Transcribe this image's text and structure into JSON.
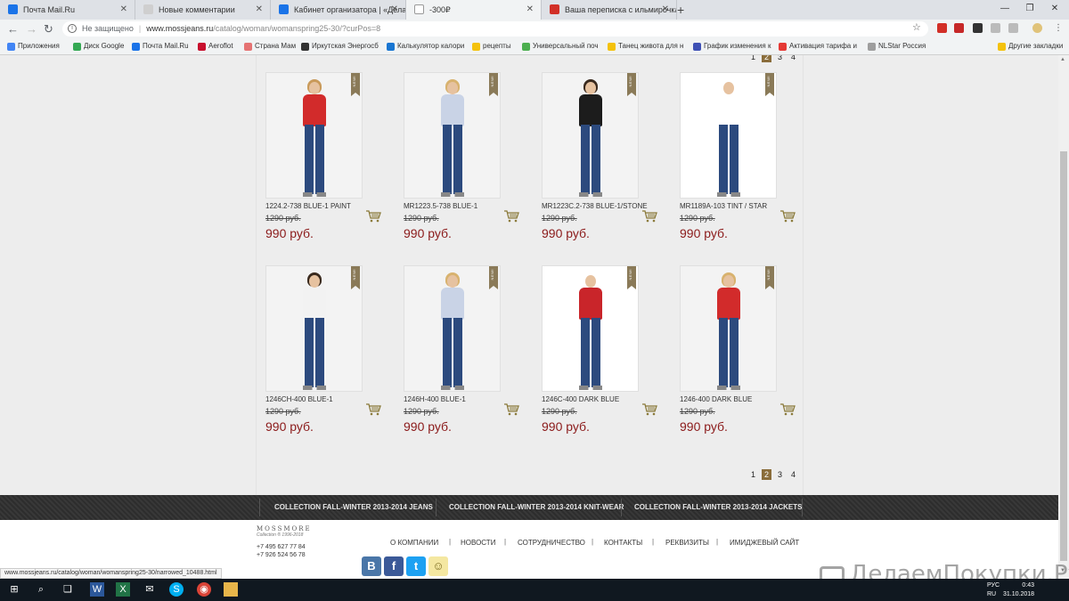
{
  "browser": {
    "tabs": [
      {
        "title": "Почта Mail.Ru",
        "color": "#1a73e8"
      },
      {
        "title": "Новые комментарии",
        "color": "#cccccc"
      },
      {
        "title": "Кабинет организатора | «Делае",
        "color": "#1a73e8"
      },
      {
        "title": "-300₽",
        "color": "#ffffff"
      },
      {
        "title": "Ваша переписка с ильмирочка",
        "color": "#d22f27"
      }
    ],
    "url": {
      "security": "Не защищено",
      "host": "www.mossjeans.ru",
      "path": "/catalog/woman/womanspring25-30/?curPos=8"
    },
    "bookmarks": [
      {
        "label": "Приложения",
        "color": "#4285f4"
      },
      {
        "label": "Диск Google",
        "color": "#34a853"
      },
      {
        "label": "Почта Mail.Ru",
        "color": "#1a73e8"
      },
      {
        "label": "Aeroflot",
        "color": "#c8102e"
      },
      {
        "label": "Страна Мам",
        "color": "#e57373"
      },
      {
        "label": "Иркутская Энергосб",
        "color": "#333333"
      },
      {
        "label": "Калькулятор калори",
        "color": "#1976d2"
      },
      {
        "label": "рецепты",
        "color": "#f4c20d"
      },
      {
        "label": "Универсальный поч",
        "color": "#4caf50"
      },
      {
        "label": "Танец живота для н",
        "color": "#f4c20d"
      },
      {
        "label": "График изменения к",
        "color": "#3f51b5"
      },
      {
        "label": "Активация тарифа и",
        "color": "#e53935"
      },
      {
        "label": "NLStar Россия",
        "color": "#9e9e9e"
      },
      {
        "label": "Другие закладки",
        "color": "#f4c20d"
      }
    ],
    "status_url": "www.mossjeans.ru/catalog/woman/womanspring25-30/narrowed_10488.html"
  },
  "pager": {
    "pages": [
      "1",
      "2",
      "3",
      "4"
    ],
    "current": "2"
  },
  "new_badge": "NEW!",
  "products": [
    {
      "name": "1224.2-738 BLUE-1 PAINT",
      "old_price": "1290 руб.",
      "price": "990 руб.",
      "top_color": "#d22b2b",
      "hair_color": "#c99a5a",
      "bg": "gray"
    },
    {
      "name": "MR1223.5-738 BLUE-1",
      "old_price": "1290 руб.",
      "price": "990 руб.",
      "top_color": "#c9d3e6",
      "hair_color": "#d8b26e",
      "bg": "gray"
    },
    {
      "name": "MR1223C.2-738 BLUE-1/STONE",
      "old_price": "1290 руб.",
      "price": "990 руб.",
      "top_color": "#1c1c1c",
      "hair_color": "#3a2a1e",
      "bg": "gray"
    },
    {
      "name": "MR1189A-103 TINT / STAR",
      "old_price": "1290 руб.",
      "price": "990 руб.",
      "top_color": "#ffffff",
      "hair_color": "#ffffff",
      "bg": "white"
    },
    {
      "name": "1246CH-400 BLUE-1",
      "old_price": "1290 руб.",
      "price": "990 руб.",
      "top_color": "#f2f2f2",
      "hair_color": "#3a2a1e",
      "bg": "gray"
    },
    {
      "name": "1246H-400 BLUE-1",
      "old_price": "1290 руб.",
      "price": "990 руб.",
      "top_color": "#c9d3e6",
      "hair_color": "#d8b26e",
      "bg": "gray"
    },
    {
      "name": "1246C-400 DARK BLUE",
      "old_price": "1290 руб.",
      "price": "990 руб.",
      "top_color": "#c9252a",
      "hair_color": "#ffffff",
      "bg": "white"
    },
    {
      "name": "1246-400 DARK BLUE",
      "old_price": "1290 руб.",
      "price": "990 руб.",
      "top_color": "#d22b2b",
      "hair_color": "#d8b26e",
      "bg": "gray"
    }
  ],
  "collections": [
    "COLLECTION FALL-WINTER 2013-2014 JEANS",
    "COLLECTION FALL-WINTER 2013-2014 KNIT-WEAR",
    "COLLECTION FALL-WINTER 2013-2014 JACKETS"
  ],
  "footer": {
    "logo": "MOSSMORE",
    "logo_sub": "Collection",
    "logo_years": "® 1996-2018",
    "phones": [
      "+7 495 627 77 84",
      "+7 926 524 56 78"
    ],
    "nav": [
      "О КОМПАНИИ",
      "НОВОСТИ",
      "СОТРУДНИЧЕСТВО",
      "КОНТАКТЫ",
      "РЕКВИЗИТЫ",
      "ИМИДЖЕВЫЙ САЙТ"
    ],
    "social": [
      {
        "label": "В",
        "color": "#4a76a8"
      },
      {
        "label": "f",
        "color": "#3b5998"
      },
      {
        "label": "t",
        "color": "#1da1f2"
      },
      {
        "label": "☺",
        "color": "#f4e7a1"
      }
    ]
  },
  "watermark": "ДелаемПокупки.Ру",
  "taskbar": {
    "lang": "РУС",
    "lang2": "RU",
    "time": "0:43",
    "date": "31.10.2018"
  },
  "accent_color": "#8b1a1a",
  "badge_color": "#8a7a58"
}
